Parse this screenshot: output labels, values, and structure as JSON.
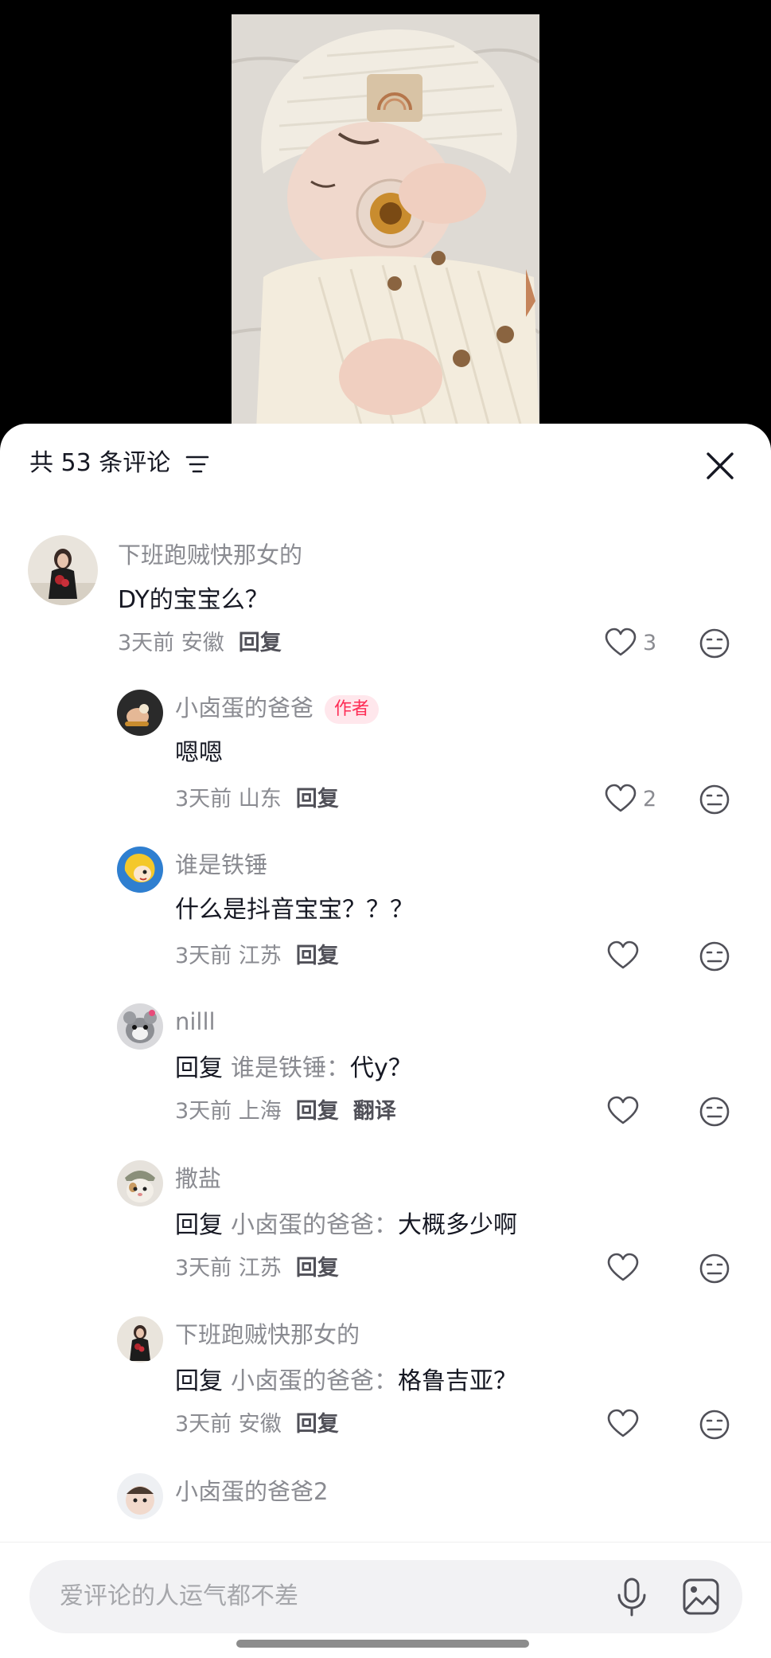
{
  "header": {
    "comment_count_label": "共 53 条评论"
  },
  "input": {
    "placeholder": "爱评论的人运气都不差"
  },
  "colors": {
    "accent": "#fe2c55",
    "text": "#161823",
    "muted": "#8a8b91"
  },
  "comments": [
    {
      "username": "下班跑贼快那女的",
      "text": "DY的宝宝么？",
      "time_location": "3天前 安徽",
      "reply_label": "回复",
      "likes": "3"
    },
    {
      "username": "小卤蛋的爸爸",
      "author_badge": "作者",
      "text": "嗯嗯",
      "time_location": "3天前 山东",
      "reply_label": "回复",
      "likes": "2"
    },
    {
      "username": "谁是铁锤",
      "text": "什么是抖音宝宝？？？",
      "time_location": "3天前 江苏",
      "reply_label": "回复"
    },
    {
      "username": "nilll",
      "reply_prefix": "回复",
      "reply_to": "谁是铁锤：",
      "text": "代y？",
      "time_location": "3天前 上海",
      "reply_label": "回复",
      "translate_label": "翻译"
    },
    {
      "username": "撒盐",
      "reply_prefix": "回复",
      "reply_to": "小卤蛋的爸爸：",
      "text": "大概多少啊",
      "time_location": "3天前 江苏",
      "reply_label": "回复"
    },
    {
      "username": "下班跑贼快那女的",
      "reply_prefix": "回复",
      "reply_to": "小卤蛋的爸爸：",
      "text": "格鲁吉亚？",
      "time_location": "3天前 安徽",
      "reply_label": "回复"
    },
    {
      "username": "小卤蛋的爸爸2"
    }
  ],
  "icons": {
    "filter": "filter-icon",
    "close": "close-icon",
    "like": "heart-icon",
    "dislike": "dislike-face-icon",
    "mic": "microphone-icon",
    "image": "image-icon"
  }
}
